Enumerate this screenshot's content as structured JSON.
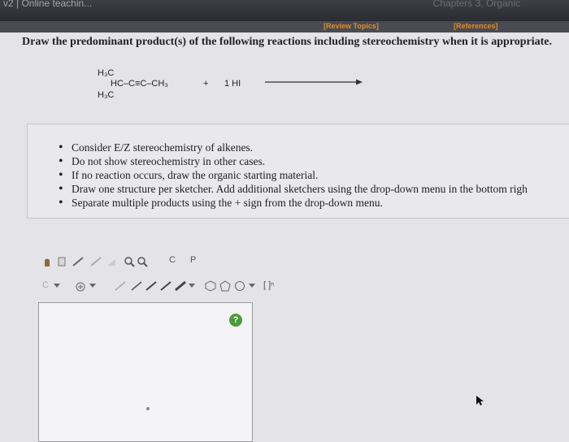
{
  "topbar": {
    "left_text": "v2 | Online teachin...",
    "right_text": "Chapters 3, Organic"
  },
  "links": {
    "review": "[Review Topics]",
    "references": "[References]"
  },
  "question": "Draw the predominant product(s) of the following reactions including stereochemistry when it is appropriate.",
  "reaction": {
    "h3c_top": "H₃C",
    "chain": "HC–C≡C–CH₃",
    "h3c_bottom": "H₃C",
    "plus": "+",
    "reagent": "1 HI"
  },
  "hints": [
    "Consider E/Z stereochemistry of alkenes.",
    "Do not show stereochemistry in other cases.",
    "If no reaction occurs, draw the organic starting material.",
    "Draw one structure per sketcher. Add additional sketchers using the drop-down menu in the bottom righ",
    "Separate multiple products using the + sign from the drop-down menu."
  ],
  "toolbar": {
    "template_label": "C",
    "pcl_label": "P",
    "bracket_label": "[ ]ⁿ"
  },
  "help_label": "?"
}
